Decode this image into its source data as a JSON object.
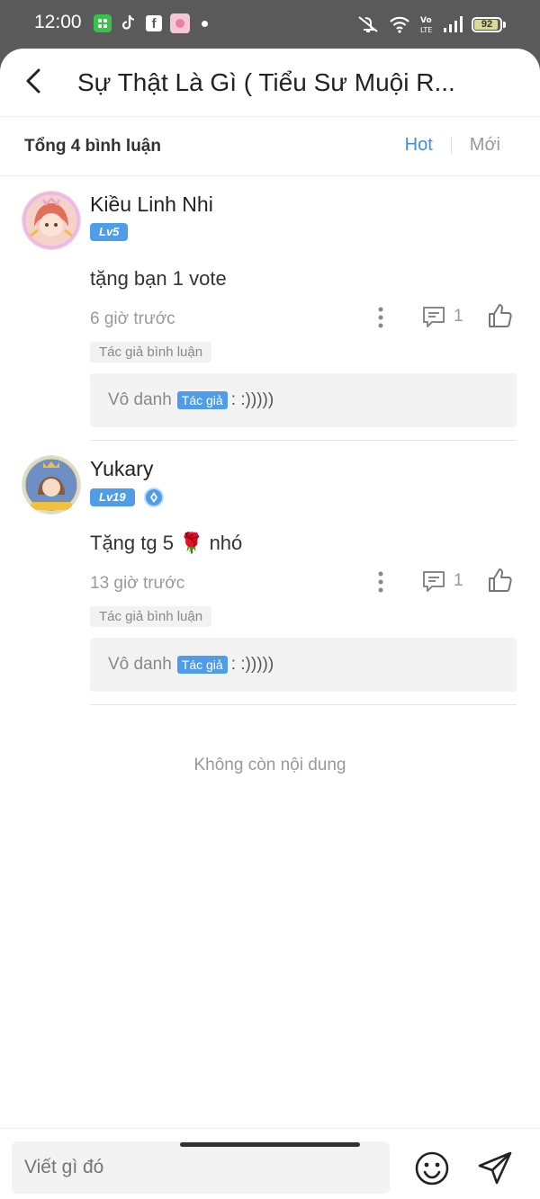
{
  "status_bar": {
    "time": "12:00",
    "battery": "92",
    "battery_level": 0.92,
    "icons": [
      "grid-app-icon",
      "tiktok-icon",
      "facebook-icon",
      "pink-app-icon",
      "mute-icon",
      "wifi-icon",
      "volte-icon",
      "signal-icon",
      "battery-icon"
    ]
  },
  "header": {
    "title": "Sự Thật Là Gì ( Tiểu Sư Muội R..."
  },
  "summary": {
    "total": "Tổng 4 bình luận",
    "sort_hot": "Hot",
    "sort_new": "Mới"
  },
  "comments": [
    {
      "name": "Kiều Linh Nhi",
      "level": "Lv5",
      "text": "tặng bạn 1 vote",
      "time": "6 giờ trước",
      "reply_count": "1",
      "tag": "Tác giả bình luận",
      "reply": {
        "user": "Vô danh",
        "badge": "Tác giả",
        "text": ": :)))))"
      }
    },
    {
      "name": "Yukary",
      "level": "Lv19",
      "text": "Tặng tg 5 🌹 nhó",
      "time": "13 giờ trước",
      "reply_count": "1",
      "tag": "Tác giả bình luận",
      "reply": {
        "user": "Vô danh",
        "badge": "Tác giả",
        "text": ": :)))))"
      }
    }
  ],
  "end_text": "Không còn nội dung",
  "footer": {
    "placeholder": "Viết gì đó"
  },
  "colors": {
    "accent": "#3a8fe0",
    "badge": "#4f9de8"
  }
}
